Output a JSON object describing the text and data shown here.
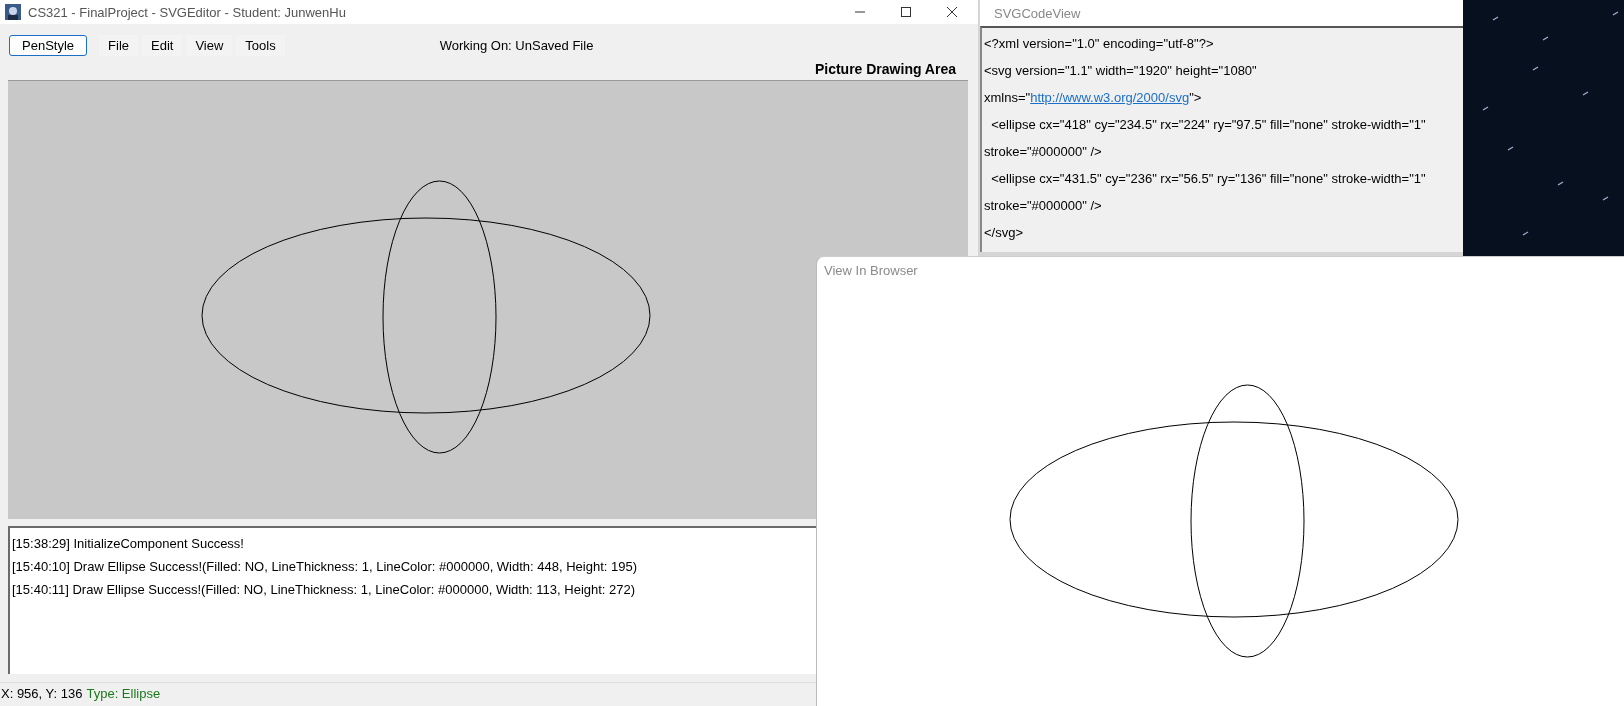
{
  "main_window": {
    "title": "CS321 - FinalProject - SVGEditor - Student: JunwenHu",
    "menu": [
      {
        "label": "PenStyle",
        "kind": "button"
      },
      {
        "label": "File",
        "kind": "menu"
      },
      {
        "label": "Edit",
        "kind": "menu"
      },
      {
        "label": "View",
        "kind": "menu"
      },
      {
        "label": "Tools",
        "kind": "menu"
      }
    ],
    "working_on": "Working On: UnSaved File",
    "canvas_heading": "Picture Drawing Area",
    "log": [
      "[15:38:29] InitializeComponent Success!",
      "[15:40:10] Draw Ellipse Success!(Filled: NO, LineThickness: 1, LineColor: #000000, Width: 448, Height: 195)",
      "[15:40:11] Draw Ellipse Success!(Filled: NO, LineThickness: 1, LineColor: #000000, Width: 113, Height: 272)"
    ],
    "status_bar": {
      "position": "X: 956, Y: 136",
      "type": "Type: Ellipse"
    }
  },
  "code_window": {
    "title": "SVGCodeView",
    "lines": [
      {
        "text": "<?xml version=\"1.0\" encoding=\"utf-8\"?>"
      },
      {
        "text": "<svg version=\"1.1\" width=\"1920\" height=\"1080\""
      },
      {
        "text": "xmlns=\"",
        "link": "http://www.w3.org/2000/svg",
        "after": "\">"
      },
      {
        "text": "  <ellipse cx=\"418\" cy=\"234.5\" rx=\"224\" ry=\"97.5\" fill=\"none\" stroke-width=\"1\""
      },
      {
        "text": "stroke=\"#000000\" />"
      },
      {
        "text": "  <ellipse cx=\"431.5\" cy=\"236\" rx=\"56.5\" ry=\"136\" fill=\"none\" stroke-width=\"1\""
      },
      {
        "text": "stroke=\"#000000\" />"
      },
      {
        "text": "</svg>"
      }
    ]
  },
  "browser_window": {
    "title": "View In Browser"
  }
}
